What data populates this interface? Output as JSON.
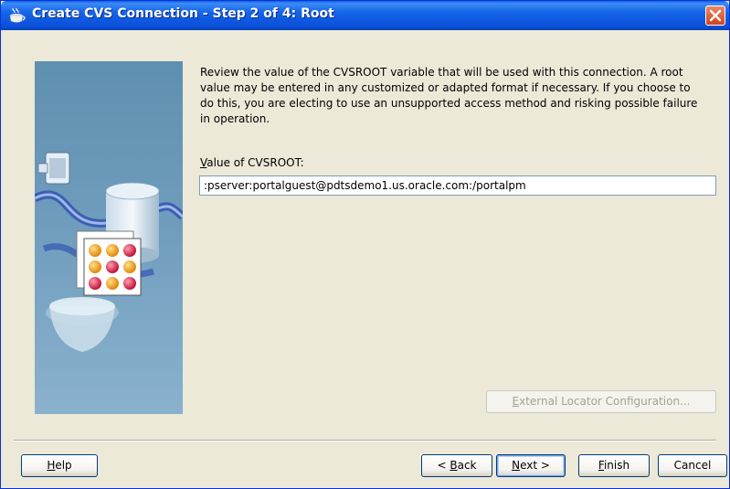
{
  "window": {
    "title": "Create CVS Connection - Step 2 of 4: Root"
  },
  "content": {
    "description": "Review the value of the CVSROOT variable that will be used with this connection. A root value may be entered in any customized or adapted format if necessary. If you choose to do this, you are electing to use an unsupported access method and risking possible failure in operation.",
    "field_label_mnemonic": "V",
    "field_label_rest": "alue of CVSROOT:",
    "cvsroot_value": ":pserver:portalguest@pdtsdemo1.us.oracle.com:/portalpm",
    "external_locator_mn": "E",
    "external_locator_rest": "xternal Locator Configuration..."
  },
  "buttons": {
    "help_mn": "H",
    "help_rest": "elp",
    "back_pre": "< ",
    "back_mn": "B",
    "back_rest": "ack",
    "next_mn": "N",
    "next_rest": "ext >",
    "finish_mn": "F",
    "finish_rest": "inish",
    "cancel": "Cancel"
  },
  "colors": {
    "titlebar": "#0a4fd8",
    "dialog_bg": "#ece9d8",
    "close_button": "#d2411a",
    "illustration_bg": "#6f9cbc"
  }
}
